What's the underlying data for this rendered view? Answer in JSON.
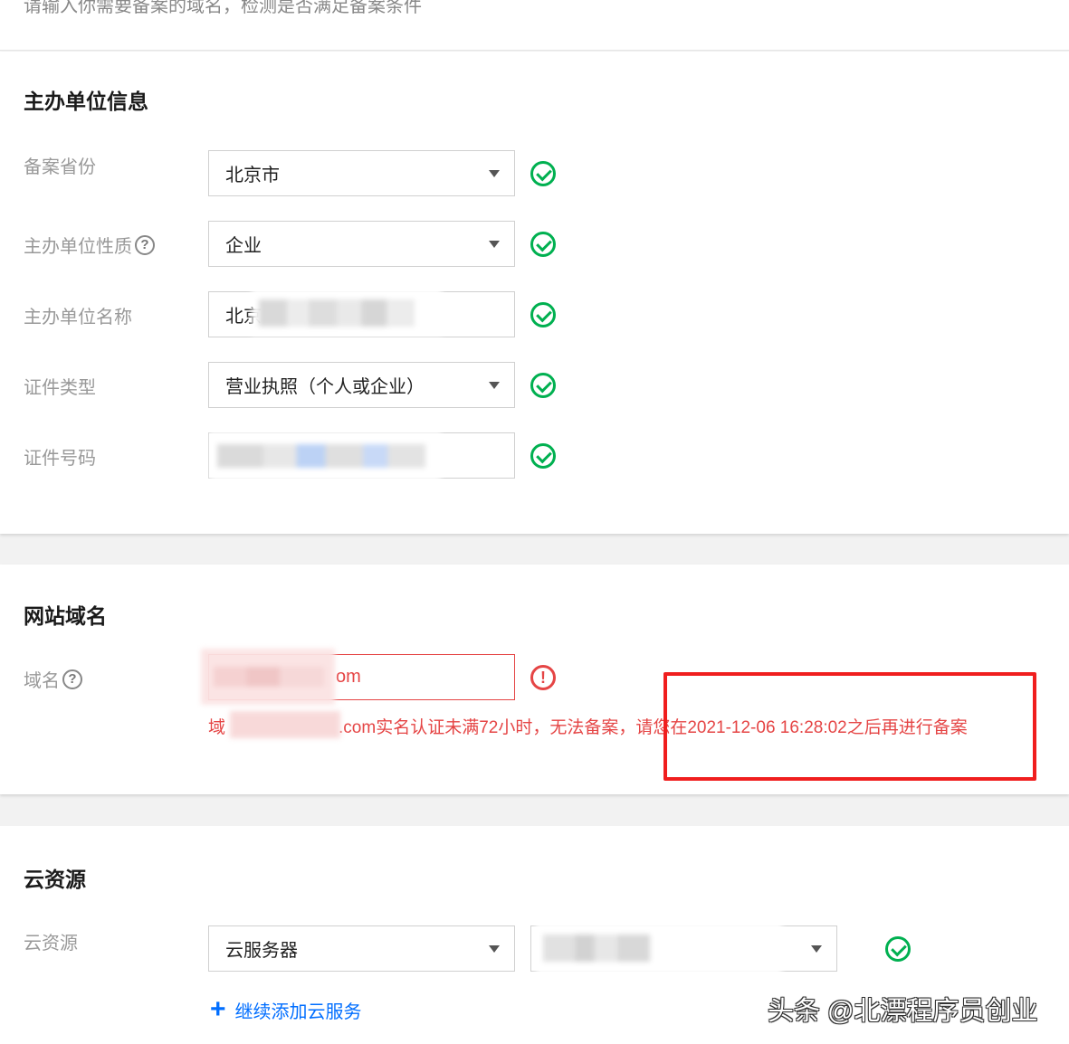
{
  "top_hint": "请输入你需要备案的域名，检测是否满足备案条件",
  "org_section": {
    "title": "主办单位信息",
    "fields": [
      {
        "label": "备案省份",
        "value": "北京市",
        "type": "select",
        "status": "ok"
      },
      {
        "label": "主办单位性质",
        "value": "企业",
        "type": "select",
        "status": "ok",
        "help": "?"
      },
      {
        "label": "主办单位名称",
        "value": "北京",
        "type": "input",
        "status": "ok"
      },
      {
        "label": "证件类型",
        "value": "营业执照（个人或企业）",
        "type": "select",
        "status": "ok"
      },
      {
        "label": "证件号码",
        "value": "",
        "type": "input",
        "status": "ok"
      }
    ]
  },
  "domain_section": {
    "title": "网站域名",
    "label": "域名",
    "help": "?",
    "value_suffix": "om",
    "status": "error",
    "error_prefix": "域",
    "error_text": ".com实名认证未满72小时，无法备案，请您在2021-12-06 16:28:02之后再进行备案"
  },
  "cloud_section": {
    "title": "云资源",
    "label": "云资源",
    "type_value": "云服务器",
    "instance_value": "",
    "status": "ok",
    "add_link": "继续添加云服务"
  },
  "watermark": "头条 @北漂程序员创业",
  "colors": {
    "success": "#00b050",
    "error": "#e54545",
    "link": "#006eff",
    "highlight_box": "#f01e1e"
  }
}
